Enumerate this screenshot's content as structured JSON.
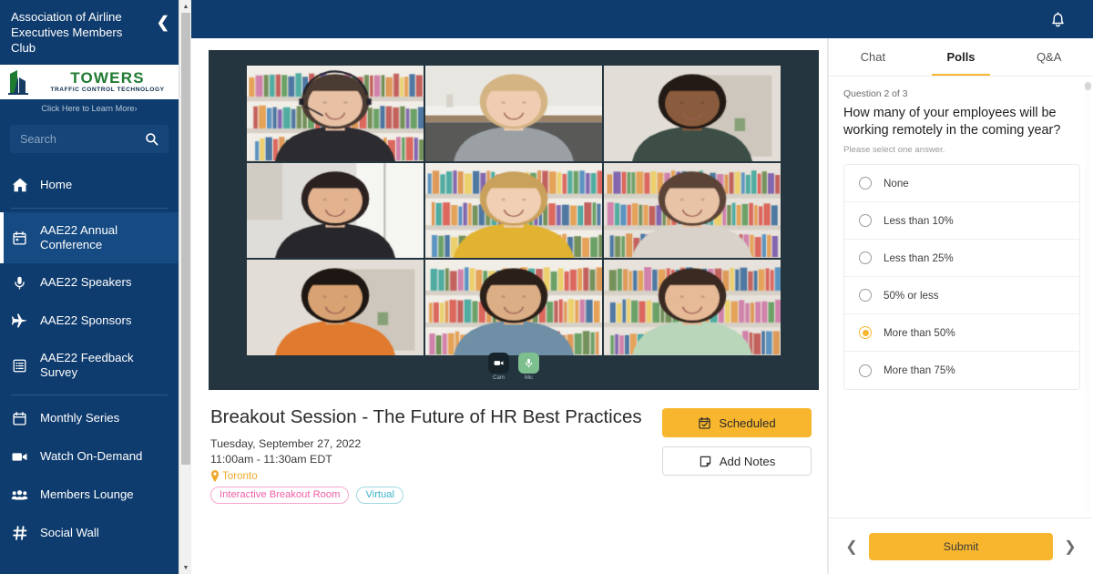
{
  "sidebar": {
    "org_title": "Association of Airline Executives Members Club",
    "collapse_icon": "chevron-left-icon",
    "ad": {
      "brand": "TOWERS",
      "tagline": "TRAFFIC CONTROL TECHNOLOGY",
      "cta": "Click Here to Learn More",
      "cta_arrow": "›"
    },
    "search": {
      "placeholder": "Search",
      "value": "",
      "icon": "search-icon"
    },
    "items": [
      {
        "label": "Home",
        "icon": "home-icon",
        "active": false
      },
      {
        "label": "AAE22 Annual Conference",
        "icon": "calendar-icon",
        "active": true
      },
      {
        "label": "AAE22 Speakers",
        "icon": "microphone-icon",
        "active": false
      },
      {
        "label": "AAE22 Sponsors",
        "icon": "airplane-icon",
        "active": false
      },
      {
        "label": "AAE22 Feedback Survey",
        "icon": "list-icon",
        "active": false
      },
      {
        "label": "Monthly Series",
        "icon": "calendar-icon",
        "active": false
      },
      {
        "label": "Watch On-Demand",
        "icon": "video-camera-icon",
        "active": false
      },
      {
        "label": "Members Lounge",
        "icon": "people-icon",
        "active": false
      },
      {
        "label": "Social Wall",
        "icon": "hashtag-icon",
        "active": false
      }
    ]
  },
  "topbar": {
    "notification_icon": "bell-icon"
  },
  "video": {
    "participant_count": 9,
    "controls": [
      {
        "label": "Cam",
        "icon": "camera-icon",
        "state": "off"
      },
      {
        "label": "Mic",
        "icon": "microphone-icon",
        "state": "on"
      }
    ]
  },
  "session": {
    "title": "Breakout Session - The Future of HR Best Practices",
    "date": "Tuesday, September 27, 2022",
    "time": "11:00am - 11:30am EDT",
    "location": "Toronto",
    "location_icon": "map-pin-icon",
    "tags": [
      {
        "label": "Interactive Breakout Room",
        "color": "#ee5fa7"
      },
      {
        "label": "Virtual",
        "color": "#3fb3c6"
      }
    ],
    "buttons": [
      {
        "label": "Scheduled",
        "icon": "calendar-check-icon",
        "style": "primary"
      },
      {
        "label": "Add Notes",
        "icon": "note-icon",
        "style": "secondary"
      }
    ]
  },
  "panel": {
    "tabs": [
      {
        "label": "Chat",
        "active": false
      },
      {
        "label": "Polls",
        "active": true
      },
      {
        "label": "Q&A",
        "active": false
      }
    ],
    "poll": {
      "counter": "Question 2 of 3",
      "question": "How many of your employees will be working remotely in the coming year?",
      "hint": "Please select one answer.",
      "options": [
        {
          "label": "None",
          "selected": false
        },
        {
          "label": "Less than 10%",
          "selected": false
        },
        {
          "label": "Less than 25%",
          "selected": false
        },
        {
          "label": "50% or less",
          "selected": false
        },
        {
          "label": "More than 50%",
          "selected": true
        },
        {
          "label": "More than 75%",
          "selected": false
        }
      ],
      "prev_icon": "chevron-left-icon",
      "next_icon": "chevron-right-icon",
      "submit_label": "Submit"
    }
  },
  "colors": {
    "brand_blue": "#0f3c6e",
    "accent_yellow": "#f7b62d",
    "video_bg": "#24353f",
    "tag_pink": "#ee5fa7",
    "tag_teal": "#3fb3c6",
    "location_orange": "#f0a92c"
  }
}
